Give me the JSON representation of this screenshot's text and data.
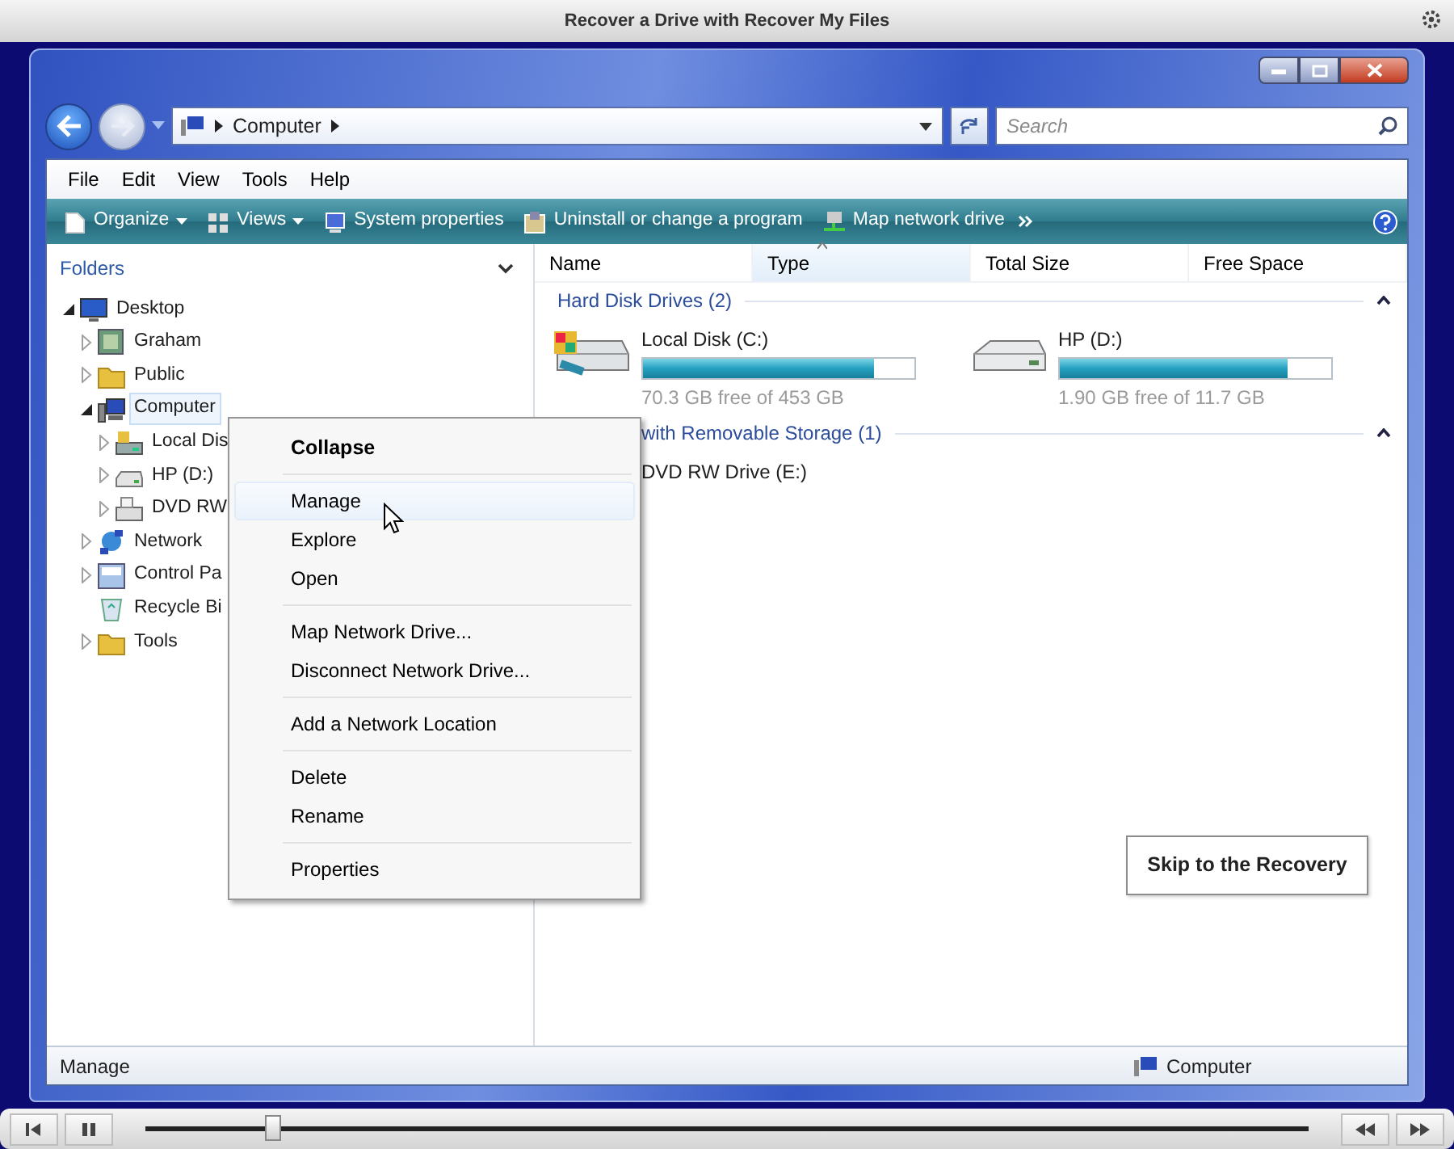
{
  "player": {
    "title": "Recover a Drive with Recover My Files",
    "seek": {
      "level": 0.11
    }
  },
  "explorer": {
    "address": {
      "crumbs": [
        "Computer"
      ]
    },
    "search": {
      "placeholder": "Search"
    },
    "menu_bar": [
      "File",
      "Edit",
      "View",
      "Tools",
      "Help"
    ],
    "toolbar": [
      {
        "label": "Organize",
        "kind": "dropdown"
      },
      {
        "label": "Views",
        "kind": "dropdown"
      },
      {
        "label": "System properties",
        "kind": "button"
      },
      {
        "label": "Uninstall or change a program",
        "kind": "button"
      },
      {
        "label": "Map network drive",
        "kind": "button"
      }
    ],
    "folders": {
      "title": "Folders",
      "tree": [
        {
          "label": "Desktop",
          "kind": "desktop",
          "expandable": true,
          "expanded": true,
          "selected": false,
          "children": [
            {
              "label": "Graham",
              "kind": "user",
              "expandable": true,
              "expanded": false,
              "selected": false
            },
            {
              "label": "Public",
              "kind": "folder",
              "expandable": true,
              "expanded": false,
              "selected": false
            },
            {
              "label": "Computer",
              "kind": "computer",
              "expandable": true,
              "expanded": true,
              "selected": true,
              "children": [
                {
                  "label": "Local Dis",
                  "kind": "system-drive",
                  "expandable": true,
                  "expanded": false,
                  "selected": false
                },
                {
                  "label": "HP (D:)",
                  "kind": "drive",
                  "expandable": true,
                  "expanded": false,
                  "selected": false
                },
                {
                  "label": "DVD RW",
                  "kind": "optical",
                  "expandable": true,
                  "expanded": false,
                  "selected": false
                }
              ]
            },
            {
              "label": "Network",
              "kind": "network",
              "expandable": true,
              "expanded": false,
              "selected": false
            },
            {
              "label": "Control Pa",
              "kind": "control-panel",
              "expandable": true,
              "expanded": false,
              "selected": false
            },
            {
              "label": "Recycle Bi",
              "kind": "recycle-bin",
              "expandable": false,
              "selected": false
            },
            {
              "label": "Tools",
              "kind": "folder",
              "expandable": true,
              "expanded": false,
              "selected": false
            }
          ]
        }
      ]
    },
    "columns": [
      {
        "label": "Name",
        "selected": false
      },
      {
        "label": "Type",
        "selected": true
      },
      {
        "label": "Total Size",
        "selected": false
      },
      {
        "label": "Free Space",
        "selected": false
      }
    ],
    "groups": [
      {
        "title": "Hard Disk Drives (2)",
        "items": [
          {
            "name": "Local Disk (C:)",
            "kind": "system-drive",
            "level": 0.85,
            "free": "70.3 GB free of 453 GB"
          },
          {
            "name": "HP (D:)",
            "kind": "drive",
            "level": 0.84,
            "free": "1.90 GB free of 11.7 GB"
          }
        ]
      },
      {
        "title": "with Removable Storage (1)",
        "items": [
          {
            "name": "DVD RW Drive (E:)"
          }
        ]
      }
    ],
    "status_bar": {
      "left": "Manage",
      "right": "Computer"
    }
  },
  "context_menu": {
    "groups": [
      [
        {
          "label": "Collapse",
          "default": true,
          "selected": false
        }
      ],
      [
        {
          "label": "Manage",
          "default": false,
          "selected": true
        },
        {
          "label": "Explore",
          "default": false,
          "selected": false
        },
        {
          "label": "Open",
          "default": false,
          "selected": false
        }
      ],
      [
        {
          "label": "Map Network Drive...",
          "default": false,
          "selected": false
        },
        {
          "label": "Disconnect Network Drive...",
          "default": false,
          "selected": false
        }
      ],
      [
        {
          "label": "Add a Network Location",
          "default": false,
          "selected": false
        }
      ],
      [
        {
          "label": "Delete",
          "default": false,
          "selected": false
        },
        {
          "label": "Rename",
          "default": false,
          "selected": false
        }
      ],
      [
        {
          "label": "Properties",
          "default": false,
          "selected": false
        }
      ]
    ]
  },
  "overlay_button": "Skip to the Recovery"
}
